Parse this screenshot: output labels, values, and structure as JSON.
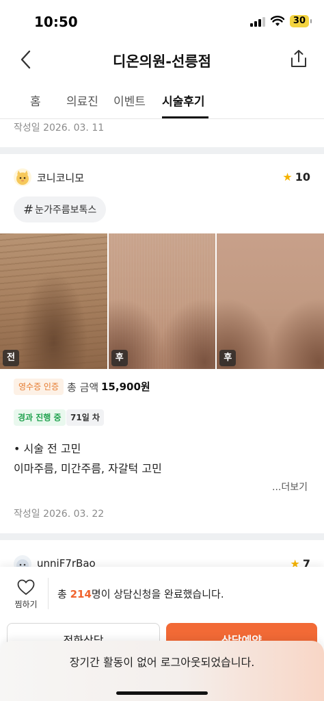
{
  "status_bar": {
    "time": "10:50",
    "battery": "30"
  },
  "header": {
    "title": "디온의원-선릉점"
  },
  "tabs": [
    {
      "label": "홈"
    },
    {
      "label": "의료진"
    },
    {
      "label": "이벤트"
    },
    {
      "label": "시술후기",
      "active": true
    }
  ],
  "previous_review": {
    "date": "작성일 2026. 03. 11"
  },
  "review": {
    "author": "코니코니모",
    "rating": "10",
    "hashtag": "눈가주름보톡스",
    "photos": [
      {
        "tag": "전"
      },
      {
        "tag": "후"
      },
      {
        "tag": "후"
      }
    ],
    "receipt_badge": "영수증 인증",
    "total_label": "총 금액",
    "total_amount": "15,900원",
    "progress_badge": "경과 진행 중",
    "day_badge": "71일 차",
    "body_line1": "• 시술 전 고민",
    "body_line2": "이마주름, 미간주름, 자갈턱 고민",
    "more_label": "...더보기",
    "date": "작성일 2026. 03. 22"
  },
  "next_review": {
    "author": "unniF7rBao",
    "rating": "7"
  },
  "consult_bar": {
    "wish_label": "찜하기",
    "text_prefix": "총 ",
    "count": "214",
    "text_suffix": "명이 상담신청을 완료했습니다.",
    "phone_button": "전화상담",
    "reserve_button": "상담예약"
  },
  "toast": {
    "message": "장기간 활동이 없어 로그아웃되었습니다."
  },
  "colors": {
    "accent": "#f26a36",
    "star": "#f5b301",
    "green": "#22a350"
  }
}
